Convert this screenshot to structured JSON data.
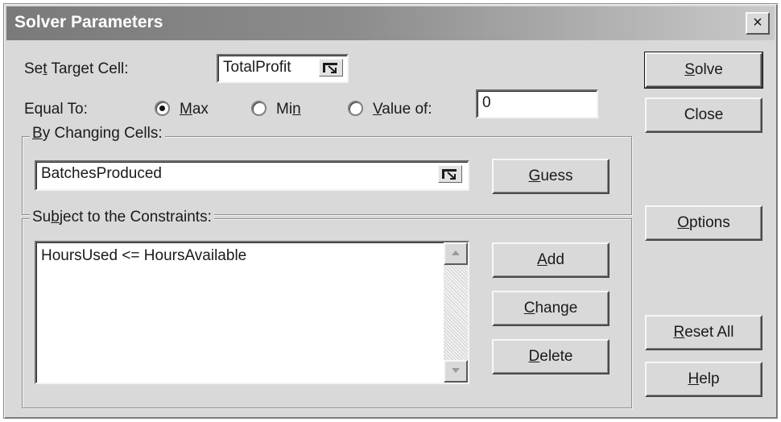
{
  "window": {
    "title": "Solver Parameters",
    "close_glyph": "×"
  },
  "target": {
    "label_pre": "Se",
    "label_key": "t",
    "label_post": " Target Cell:",
    "value": "TotalProfit"
  },
  "equal_to": {
    "label": "Equal To:",
    "selected": "Max",
    "max": {
      "key": "M",
      "rest": "ax"
    },
    "min": {
      "pre": "Mi",
      "key": "n",
      "rest": ""
    },
    "value_of": {
      "key": "V",
      "rest": "alue of:"
    },
    "value_input": "0"
  },
  "changing": {
    "group_key": "B",
    "group_rest": "y Changing Cells:",
    "value": "BatchesProduced",
    "guess": {
      "key": "G",
      "rest": "uess"
    }
  },
  "constraints": {
    "group_pre": "Su",
    "group_key": "b",
    "group_rest": "ject to the Constraints:",
    "items": [
      "HoursUsed <= HoursAvailable"
    ],
    "add": {
      "key": "A",
      "rest": "dd"
    },
    "change": {
      "key": "C",
      "rest": "hange"
    },
    "delete": {
      "key": "D",
      "rest": "elete"
    }
  },
  "side_buttons": {
    "solve": {
      "key": "S",
      "rest": "olve"
    },
    "close": "Close",
    "options": {
      "key": "O",
      "rest": "ptions"
    },
    "reset_all": {
      "key": "R",
      "rest": "eset All"
    },
    "help": {
      "key": "H",
      "rest": "elp"
    }
  },
  "icons": {
    "collapse": "collapse-dialog-icon",
    "scroll_up": "scroll-up-arrow-icon",
    "scroll_down": "scroll-down-arrow-icon",
    "close": "close-icon"
  }
}
